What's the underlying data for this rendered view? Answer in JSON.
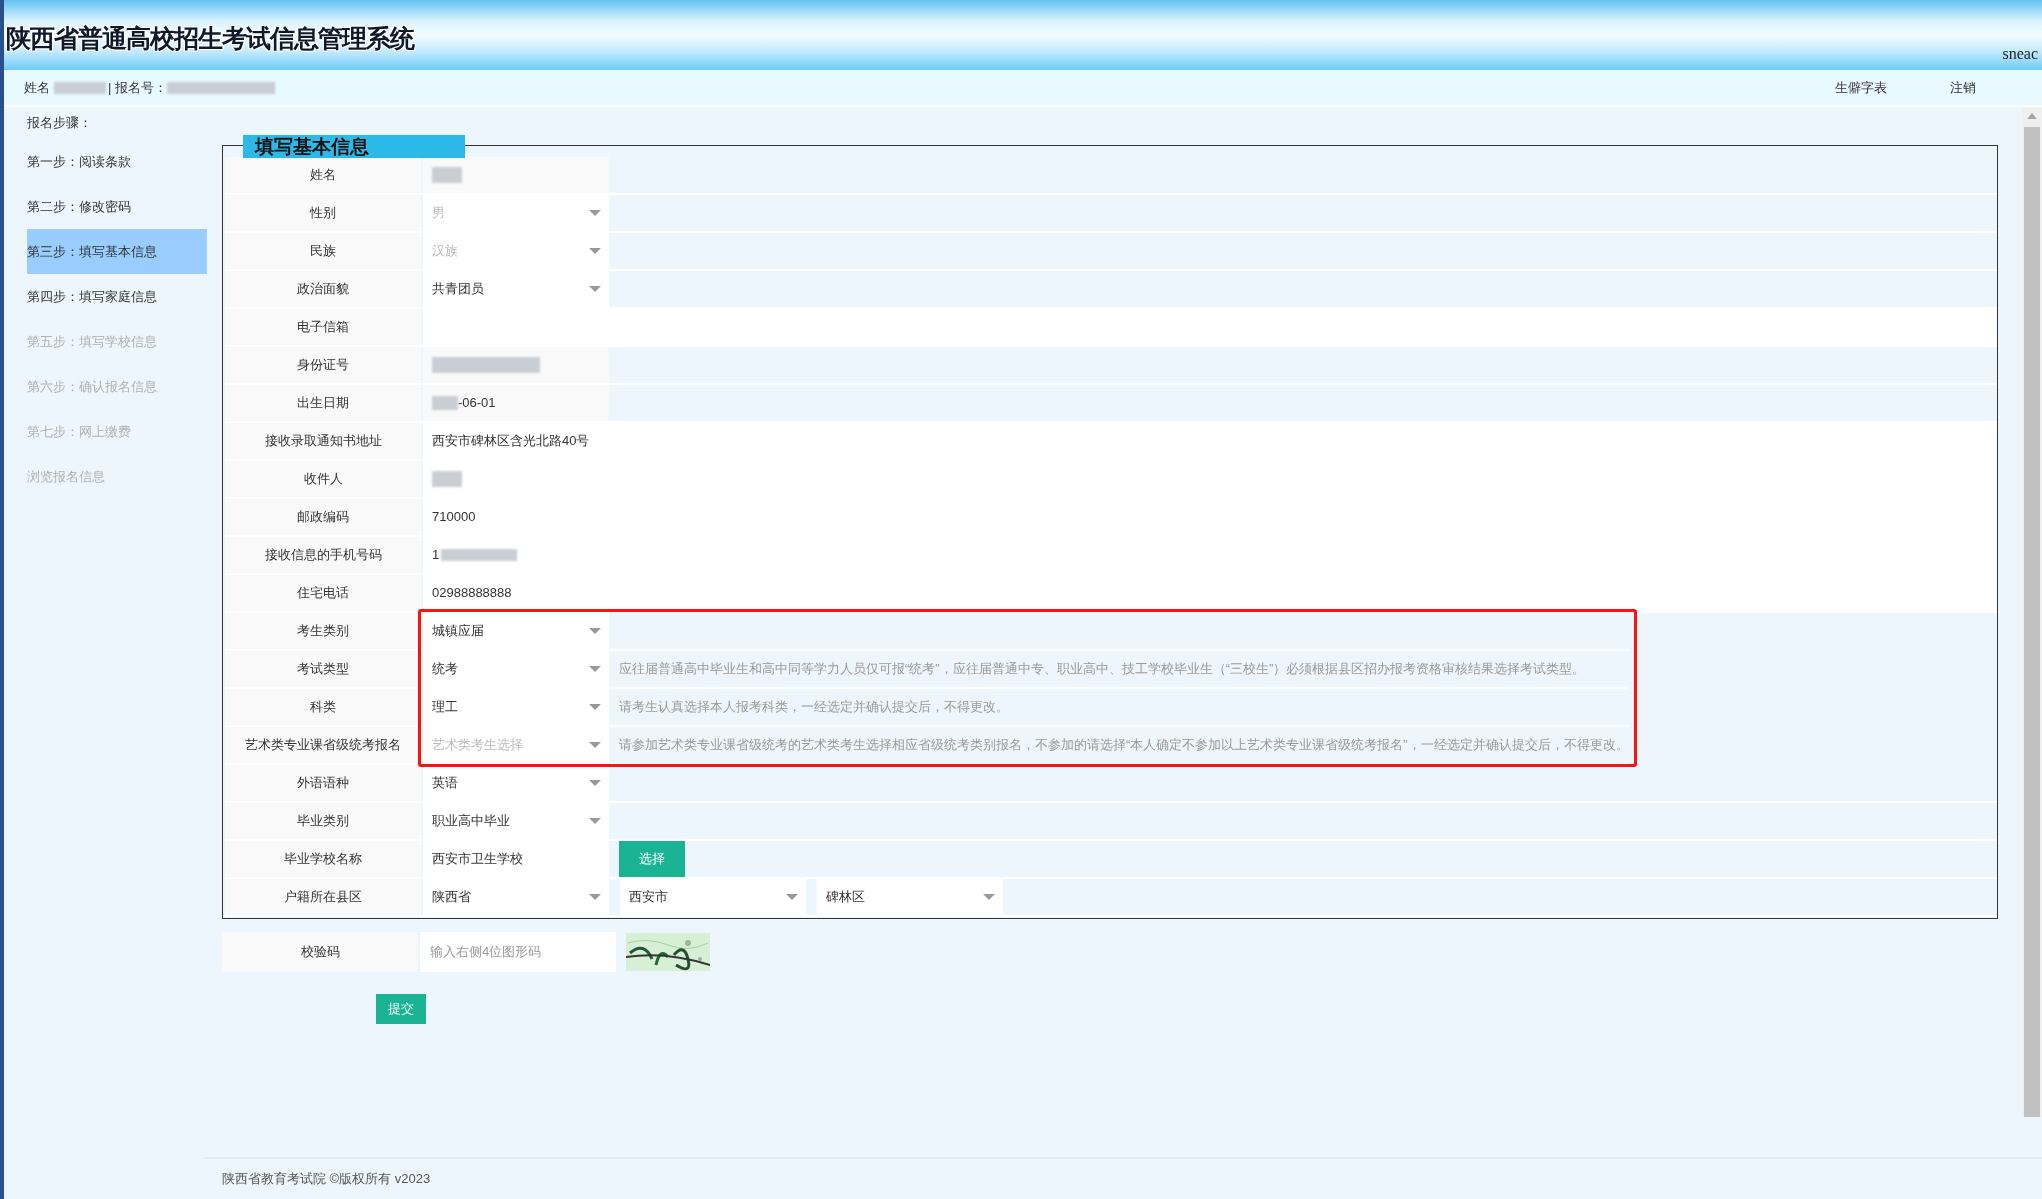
{
  "header": {
    "title": "陕西省普通高校招生考试信息管理系统",
    "badge": "sneac"
  },
  "user_bar": {
    "name_label": "姓名",
    "id_label": "| 报名号：",
    "links": [
      "生僻字表",
      "注销"
    ]
  },
  "sidebar": {
    "heading": "报名步骤：",
    "items": [
      {
        "label": "第一步：阅读条款",
        "selected": false,
        "disabled": false
      },
      {
        "label": "第二步：修改密码",
        "selected": false,
        "disabled": false
      },
      {
        "label": "第三步：填写基本信息",
        "selected": true,
        "disabled": false
      },
      {
        "label": "第四步：填写家庭信息",
        "selected": false,
        "disabled": false
      },
      {
        "label": "第五步：填写学校信息",
        "selected": false,
        "disabled": true
      },
      {
        "label": "第六步：确认报名信息",
        "selected": false,
        "disabled": true
      },
      {
        "label": "第七步：网上缴费",
        "selected": false,
        "disabled": true
      },
      {
        "label": "浏览报名信息",
        "selected": false,
        "disabled": true
      }
    ]
  },
  "form": {
    "title": "填写基本信息",
    "rows": [
      {
        "label": "姓名",
        "kind": "readonly",
        "redacted": true
      },
      {
        "label": "性别",
        "kind": "select",
        "value": "男",
        "disabled": true
      },
      {
        "label": "民族",
        "kind": "select",
        "value": "汉族",
        "disabled": true
      },
      {
        "label": "政治面貌",
        "kind": "select",
        "value": "共青团员",
        "disabled": false
      },
      {
        "label": "电子信箱",
        "kind": "text"
      },
      {
        "label": "身份证号",
        "kind": "readonly",
        "redacted": true
      },
      {
        "label": "出生日期",
        "kind": "readonly",
        "value": "-06-01",
        "redacted_before": true
      },
      {
        "label": "接收录取通知书地址",
        "kind": "text",
        "value": "西安市碑林区含光北路40号"
      },
      {
        "label": "收件人",
        "kind": "text",
        "redacted": true
      },
      {
        "label": "邮政编码",
        "kind": "text",
        "value": "710000"
      },
      {
        "label": "接收信息的手机号码",
        "kind": "text",
        "value": "1",
        "redacted_after": true
      },
      {
        "label": "住宅电话",
        "kind": "text",
        "value": "02988888888"
      },
      {
        "label": "考生类别",
        "kind": "select",
        "value": "城镇应届",
        "disabled": false,
        "highlighted": true
      },
      {
        "label": "考试类型",
        "kind": "select",
        "value": "统考",
        "disabled": false,
        "highlighted": true,
        "hint": "应往届普通高中毕业生和高中同等学力人员仅可报“统考”，应往届普通中专、职业高中、技工学校毕业生（“三校生”）必须根据县区招办报考资格审核结果选择考试类型。"
      },
      {
        "label": "科类",
        "kind": "select",
        "value": "理工",
        "disabled": false,
        "highlighted": true,
        "hint": "请考生认真选择本人报考科类，一经选定并确认提交后，不得更改。"
      },
      {
        "label": "艺术类专业课省级统考报名",
        "kind": "select",
        "value": "艺术类考生选择",
        "disabled": true,
        "highlighted": true,
        "hint": "请参加艺术类专业课省级统考的艺术类考生选择相应省级统考类别报名，不参加的请选择“本人确定不参加以上艺术类专业课省级统考报名”，一经选定并确认提交后，不得更改。"
      },
      {
        "label": "外语语种",
        "kind": "select",
        "value": "英语",
        "disabled": false
      },
      {
        "label": "毕业类别",
        "kind": "select",
        "value": "职业高中毕业",
        "disabled": false
      },
      {
        "label": "毕业学校名称",
        "kind": "text_button",
        "value": "西安市卫生学校",
        "button": "选择"
      },
      {
        "label": "户籍所在县区",
        "kind": "region",
        "values": [
          "陕西省",
          "西安市",
          "碑林区"
        ]
      }
    ]
  },
  "captcha": {
    "label": "校验码",
    "placeholder": "输入右侧4位图形码"
  },
  "submit": "提交",
  "footer": "陕西省教育考试院 ©版权所有 v2023"
}
